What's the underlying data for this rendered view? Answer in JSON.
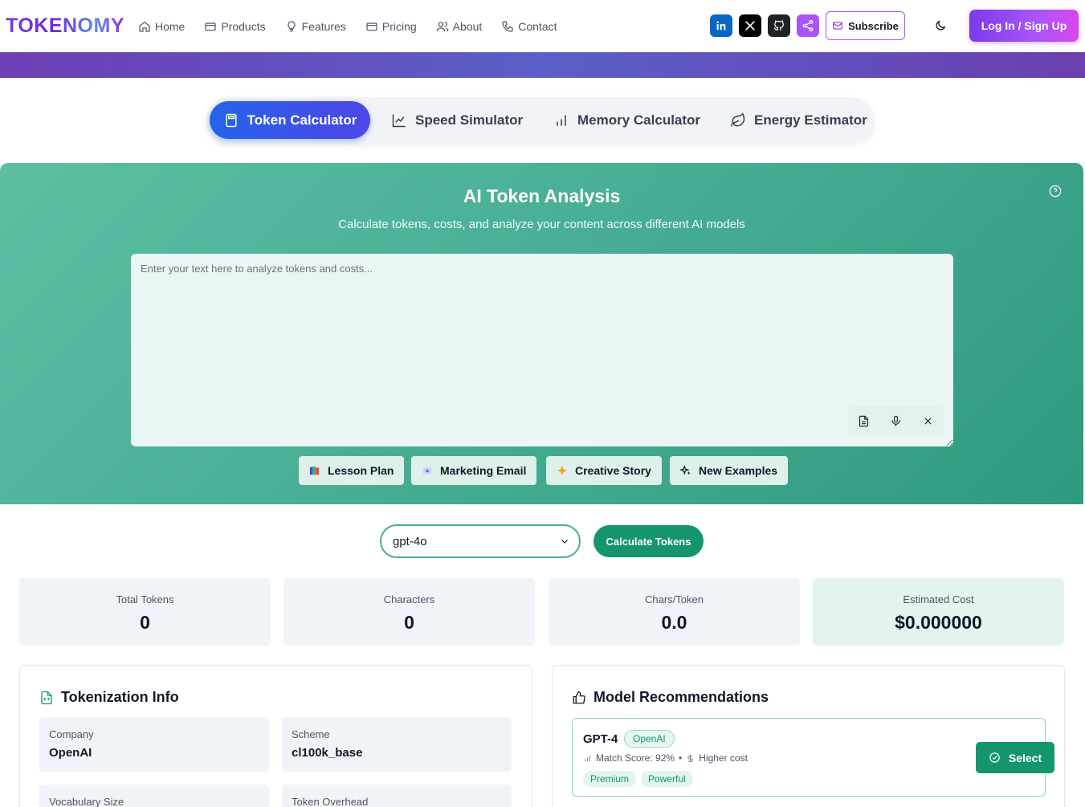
{
  "brand": "TOKENOMY",
  "nav": {
    "links": [
      {
        "label": "Home",
        "icon": "home-icon"
      },
      {
        "label": "Products",
        "icon": "card-icon"
      },
      {
        "label": "Features",
        "icon": "lightbulb-icon"
      },
      {
        "label": "Pricing",
        "icon": "credit-card-icon"
      },
      {
        "label": "About",
        "icon": "users-icon"
      },
      {
        "label": "Contact",
        "icon": "phone-icon"
      }
    ],
    "social": [
      {
        "name": "linkedin-icon",
        "color": "#0a66c2"
      },
      {
        "name": "x-icon",
        "color": "#000000"
      },
      {
        "name": "github-icon",
        "color": "#1f2328"
      },
      {
        "name": "share-icon",
        "color": "#a855f7"
      }
    ],
    "subscribe_label": "Subscribe",
    "login_label": "Log In / Sign Up"
  },
  "tool_tabs": [
    {
      "label": "Token Calculator",
      "icon": "calculator-icon",
      "active": true
    },
    {
      "label": "Speed Simulator",
      "icon": "line-chart-icon",
      "active": false
    },
    {
      "label": "Memory Calculator",
      "icon": "bar-chart-icon",
      "active": false
    },
    {
      "label": "Energy Estimator",
      "icon": "leaf-icon",
      "active": false
    }
  ],
  "analysis": {
    "title": "AI Token Analysis",
    "subtitle": "Calculate tokens, costs, and analyze your content across different AI models",
    "placeholder": "Enter your text here to analyze tokens and costs...",
    "value": "",
    "examples": [
      {
        "label": "Lesson Plan",
        "icon": "books-icon"
      },
      {
        "label": "Marketing Email",
        "icon": "email-icon"
      },
      {
        "label": "Creative Story",
        "icon": "sparkle-icon"
      },
      {
        "label": "New Examples",
        "icon": "sparkles-icon"
      }
    ]
  },
  "model": {
    "selected": "gpt-4o",
    "calculate_label": "Calculate Tokens"
  },
  "stats": [
    {
      "label": "Total Tokens",
      "value": "0"
    },
    {
      "label": "Characters",
      "value": "0"
    },
    {
      "label": "Chars/Token",
      "value": "0.0"
    },
    {
      "label": "Estimated Cost",
      "value": "$0.000000"
    }
  ],
  "tokenization_info": {
    "title": "Tokenization Info",
    "fields": [
      {
        "label": "Company",
        "value": "OpenAI"
      },
      {
        "label": "Scheme",
        "value": "cl100k_base"
      },
      {
        "label": "Vocabulary Size",
        "value": ""
      },
      {
        "label": "Token Overhead",
        "value": ""
      }
    ]
  },
  "recommendations": {
    "title": "Model Recommendations",
    "items": [
      {
        "name": "GPT-4",
        "company": "OpenAI",
        "match": "Match Score: 92%",
        "cost": "Higher cost",
        "tags": [
          "Premium",
          "Powerful"
        ],
        "select_label": "Select"
      }
    ]
  },
  "colors": {
    "accent_blue": "#2563eb",
    "accent_green": "#14956e",
    "accent_purple": "#7c3aed"
  }
}
